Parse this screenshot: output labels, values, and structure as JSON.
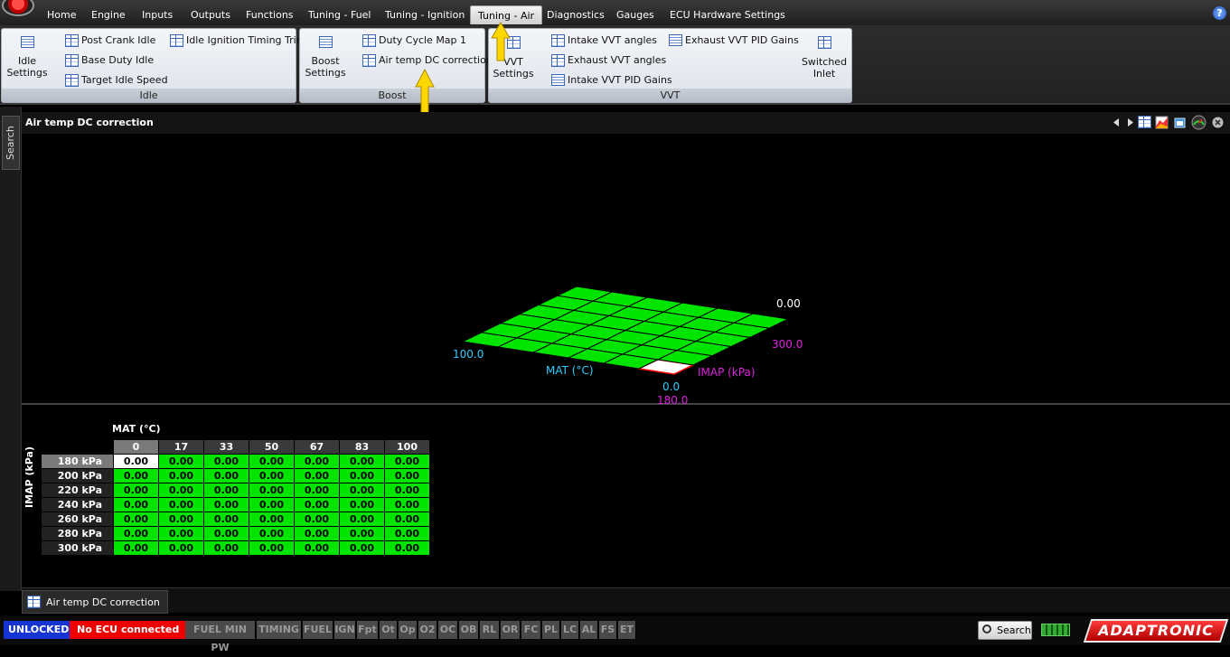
{
  "menu": {
    "tabs": [
      {
        "label": "Home"
      },
      {
        "label": "Engine"
      },
      {
        "label": "Inputs"
      },
      {
        "label": "Outputs"
      },
      {
        "label": "Functions"
      },
      {
        "label": "Tuning - Fuel"
      },
      {
        "label": "Tuning - Ignition"
      },
      {
        "label": "Tuning - Air"
      },
      {
        "label": "Diagnostics"
      },
      {
        "label": "Gauges"
      },
      {
        "label": "ECU Hardware Settings"
      }
    ],
    "help": "?"
  },
  "ribbon": {
    "idle": {
      "title": "Idle",
      "big": "Idle Settings",
      "items": [
        "Post Crank Idle",
        "Base Duty Idle",
        "Target Idle Speed",
        "Idle Ignition Timing Trim"
      ]
    },
    "boost": {
      "title": "Boost",
      "big": "Boost Settings",
      "items": [
        "Duty Cycle Map 1",
        "Air temp DC correction"
      ]
    },
    "vvt": {
      "title": "VVT",
      "big": "VVT Settings",
      "items": [
        "Intake VVT angles",
        "Exhaust VVT angles",
        "Intake VVT PID Gains",
        "Exhaust VVT PID Gains"
      ],
      "big2": "Switched Inlet"
    }
  },
  "left_rail": {
    "search_tab": "Search"
  },
  "panel": {
    "title": "Air temp DC correction"
  },
  "graph": {
    "z_max": "0.00",
    "mat_max": "100.0",
    "mat_label": "MAT (°C)",
    "mat_min": "0.0",
    "imap_label": "IMAP (kPa)",
    "imap_max": "300.0",
    "imap_min": "180.0"
  },
  "table": {
    "x_title": "MAT (°C)",
    "y_title": "IMAP (kPa)",
    "columns": [
      "0",
      "17",
      "33",
      "50",
      "67",
      "83",
      "100"
    ],
    "rows": [
      {
        "label": "180 kPa",
        "values": [
          "0.00",
          "0.00",
          "0.00",
          "0.00",
          "0.00",
          "0.00",
          "0.00"
        ]
      },
      {
        "label": "200 kPa",
        "values": [
          "0.00",
          "0.00",
          "0.00",
          "0.00",
          "0.00",
          "0.00",
          "0.00"
        ]
      },
      {
        "label": "220 kPa",
        "values": [
          "0.00",
          "0.00",
          "0.00",
          "0.00",
          "0.00",
          "0.00",
          "0.00"
        ]
      },
      {
        "label": "240 kPa",
        "values": [
          "0.00",
          "0.00",
          "0.00",
          "0.00",
          "0.00",
          "0.00",
          "0.00"
        ]
      },
      {
        "label": "260 kPa",
        "values": [
          "0.00",
          "0.00",
          "0.00",
          "0.00",
          "0.00",
          "0.00",
          "0.00"
        ]
      },
      {
        "label": "280 kPa",
        "values": [
          "0.00",
          "0.00",
          "0.00",
          "0.00",
          "0.00",
          "0.00",
          "0.00"
        ]
      },
      {
        "label": "300 kPa",
        "values": [
          "0.00",
          "0.00",
          "0.00",
          "0.00",
          "0.00",
          "0.00",
          "0.00"
        ]
      }
    ]
  },
  "doc_tab": {
    "label": "Air temp DC correction"
  },
  "status": {
    "unlocked": "UNLOCKED",
    "ecu": "No ECU connected",
    "flags": [
      "FUEL MIN PW",
      "TIMING",
      "FUEL",
      "IGN",
      "Fpt",
      "Ot",
      "Op",
      "O2",
      "OC",
      "OB",
      "RL",
      "OR",
      "FC",
      "PL",
      "LC",
      "AL",
      "FS",
      "ET"
    ],
    "search": "Search",
    "brand": "ADAPTRONIC"
  },
  "colors": {
    "cell_fill": "#00e400",
    "axis_mat": "#33ccff",
    "axis_imap": "#dd22dd",
    "unlocked": "#1634d1",
    "ecu_error": "#ee0000",
    "callout_arrow": "#ffd700"
  }
}
